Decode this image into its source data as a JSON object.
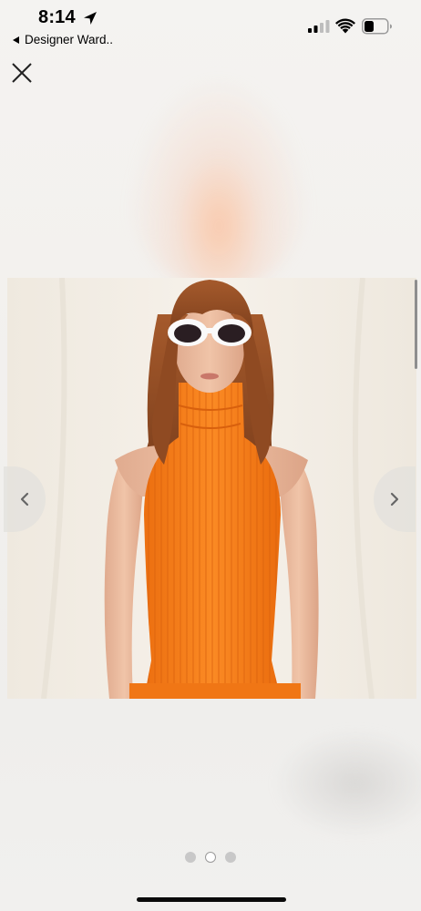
{
  "status_bar": {
    "time": "8:14",
    "back_app_label": "Designer Ward..",
    "icons": [
      "location-arrow-icon",
      "cellular-signal-icon",
      "wifi-icon",
      "battery-icon"
    ]
  },
  "viewer": {
    "close_icon": "close-icon",
    "prev_icon": "chevron-left-icon",
    "next_icon": "chevron-right-icon",
    "image": {
      "description_icon": "product-photo",
      "garment_color": "#f7811e",
      "backdrop_color": "#f3ede4"
    }
  },
  "pagination": {
    "total": 3,
    "active_index": 1
  },
  "colors": {
    "accent_orange": "#f7811e",
    "arrow_bg": "#e2e0dd",
    "text": "#000000"
  }
}
